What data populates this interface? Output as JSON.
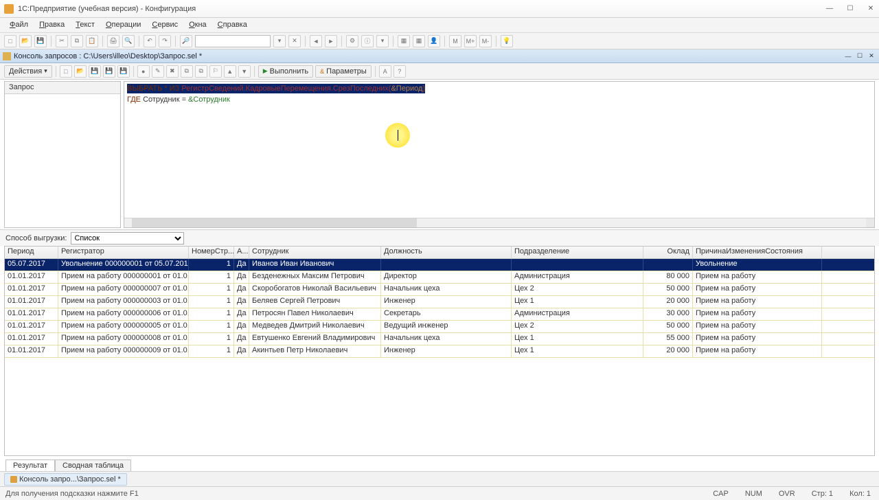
{
  "window": {
    "title": "1С:Предприятие (учебная версия) - Конфигурация"
  },
  "menu": [
    "Файл",
    "Правка",
    "Текст",
    "Операции",
    "Сервис",
    "Окна",
    "Справка"
  ],
  "subheader": {
    "text": "Консоль запросов : C:\\Users\\illeo\\Desktop\\Запрос.sel *"
  },
  "toolbar2": {
    "actions": "Действия",
    "run": "Выполнить",
    "params": "Параметры"
  },
  "sidebar": {
    "header": "Запрос"
  },
  "editor": {
    "line1_kw": "ВЫБРАТЬ * ИЗ",
    "line1_reg": " РегистрСведений.КадровыеПеремещения.СрезПоследних(",
    "line1_par": "&Период",
    "line1_close": ")",
    "line2_kw": "ГДЕ",
    "line2_txt": " Сотрудник = ",
    "line2_par": "&Сотрудник"
  },
  "outputbar": {
    "label": "Способ выгрузки:",
    "value": "Список"
  },
  "grid": {
    "headers": [
      "Период",
      "Регистратор",
      "НомерСтр...",
      "А...",
      "Сотрудник",
      "Должность",
      "Подразделение",
      "Оклад",
      "ПричинаИзмененияСостояния"
    ],
    "rows": [
      {
        "c": [
          "05.07.2017",
          "Увольнение 000000001 от 05.07.201...",
          "1",
          "Да",
          "Иванов Иван Иванович",
          "",
          "",
          "",
          "Увольнение"
        ],
        "sel": true
      },
      {
        "c": [
          "01.01.2017",
          "Прием на работу 000000001 от 01.0...",
          "1",
          "Да",
          "Безденежных Максим Петрович",
          "Директор",
          "Администрация",
          "80 000",
          "Прием на работу"
        ]
      },
      {
        "c": [
          "01.01.2017",
          "Прием на работу 000000007 от 01.0...",
          "1",
          "Да",
          "Скоробогатов Николай Васильевич",
          "Начальник цеха",
          "Цех 2",
          "50 000",
          "Прием на работу"
        ]
      },
      {
        "c": [
          "01.01.2017",
          "Прием на работу 000000003 от 01.0...",
          "1",
          "Да",
          "Беляев Сергей Петрович",
          "Инженер",
          "Цех 1",
          "20 000",
          "Прием на работу"
        ]
      },
      {
        "c": [
          "01.01.2017",
          "Прием на работу 000000006 от 01.0...",
          "1",
          "Да",
          "Петросян Павел Николаевич",
          "Секретарь",
          "Администрация",
          "30 000",
          "Прием на работу"
        ]
      },
      {
        "c": [
          "01.01.2017",
          "Прием на работу 000000005 от 01.0...",
          "1",
          "Да",
          "Медведев Дмитрий Николаевич",
          "Ведущий инженер",
          "Цех 2",
          "50 000",
          "Прием на работу"
        ]
      },
      {
        "c": [
          "01.01.2017",
          "Прием на работу 000000008 от 01.0...",
          "1",
          "Да",
          "Евтушенко Евгений Владимирович",
          "Начальник цеха",
          "Цех 1",
          "55 000",
          "Прием на работу"
        ]
      },
      {
        "c": [
          "01.01.2017",
          "Прием на работу 000000009 от 01.0...",
          "1",
          "Да",
          "Акинтьев Петр Николаевич",
          "Инженер",
          "Цех 1",
          "20 000",
          "Прием на работу"
        ]
      }
    ]
  },
  "tabs": {
    "result": "Результат",
    "pivot": "Сводная таблица"
  },
  "taskbar": {
    "btn": "Консоль запро...\\Запрос.sel *"
  },
  "status": {
    "hint": "Для получения подсказки нажмите F1",
    "num": "NUM",
    "cap": "CAP",
    "ovr": "OVR",
    "line": "Стр: 1",
    "col": "Кол: 1"
  }
}
